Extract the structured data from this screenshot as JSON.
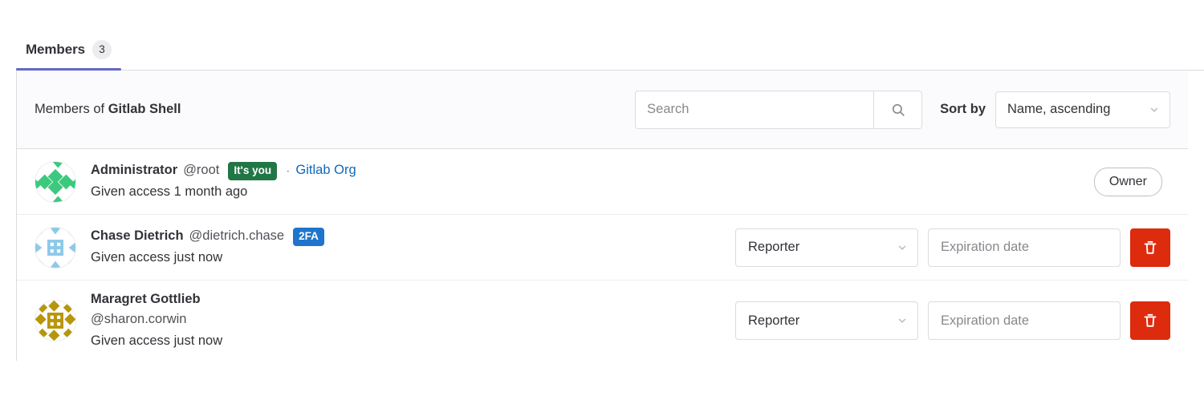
{
  "tabs": [
    {
      "label": "Members",
      "count": "3",
      "active": true
    }
  ],
  "toolbar": {
    "title_prefix": "Members of",
    "title_target": "Gitlab Shell",
    "search_placeholder": "Search",
    "search_value": "",
    "search_icon": "search-icon",
    "sort_label": "Sort by",
    "sort_value": "Name, ascending"
  },
  "members": [
    {
      "name": "Administrator",
      "handle": "@root",
      "badge": {
        "text": "It's you",
        "color": "#217645",
        "kind": "green"
      },
      "separator": "·",
      "org_link": "Gitlab Org",
      "access_text": "Given access 1 month ago",
      "role_display": "Owner",
      "role_readonly": true,
      "avatar_color": "#3cc97f",
      "handle_on_own_line": false
    },
    {
      "name": "Chase Dietrich",
      "handle": "@dietrich.chase",
      "badge": {
        "text": "2FA",
        "color": "#1f75cb",
        "kind": "blue"
      },
      "separator": "",
      "org_link": "",
      "access_text": "Given access just now",
      "role_display": "Reporter",
      "role_readonly": false,
      "expiration_placeholder": "Expiration date",
      "expiration_value": "",
      "delete_icon": "trash-icon",
      "avatar_color": "#8dc9e8",
      "handle_on_own_line": false
    },
    {
      "name": "Maragret Gottlieb",
      "handle": "@sharon.corwin",
      "badge": null,
      "separator": "",
      "org_link": "",
      "access_text": "Given access just now",
      "role_display": "Reporter",
      "role_readonly": false,
      "expiration_placeholder": "Expiration date",
      "expiration_value": "",
      "delete_icon": "trash-icon",
      "avatar_color": "#b8960c",
      "handle_on_own_line": true
    }
  ],
  "colors": {
    "accent_tab": "#6666c4",
    "link": "#1068bf",
    "danger": "#dd2b0e",
    "badge_green": "#217645",
    "badge_blue": "#1f75cb",
    "border": "#dcdcde",
    "toolbar_bg": "#fbfafd"
  }
}
